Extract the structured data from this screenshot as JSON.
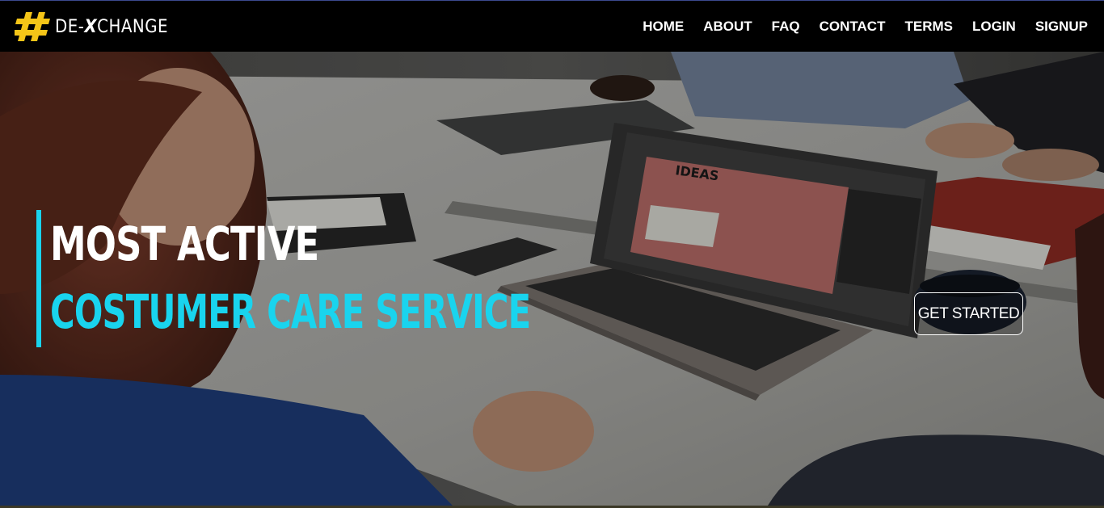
{
  "brand": {
    "prefix": "DE-",
    "x": "X",
    "suffix": "CHANGE",
    "accent": "#f5c518"
  },
  "nav": {
    "items": [
      "HOME",
      "ABOUT",
      "FAQ",
      "CONTACT",
      "TERMS",
      "LOGIN",
      "SIGNUP"
    ]
  },
  "hero": {
    "headline_1": "MOST ACTIVE",
    "headline_2": "COSTUMER CARE SERVICE",
    "headline_2_color": "#19d4ee",
    "cta_label": "GET STARTED",
    "laptop_screen_text": "IDEAS"
  }
}
